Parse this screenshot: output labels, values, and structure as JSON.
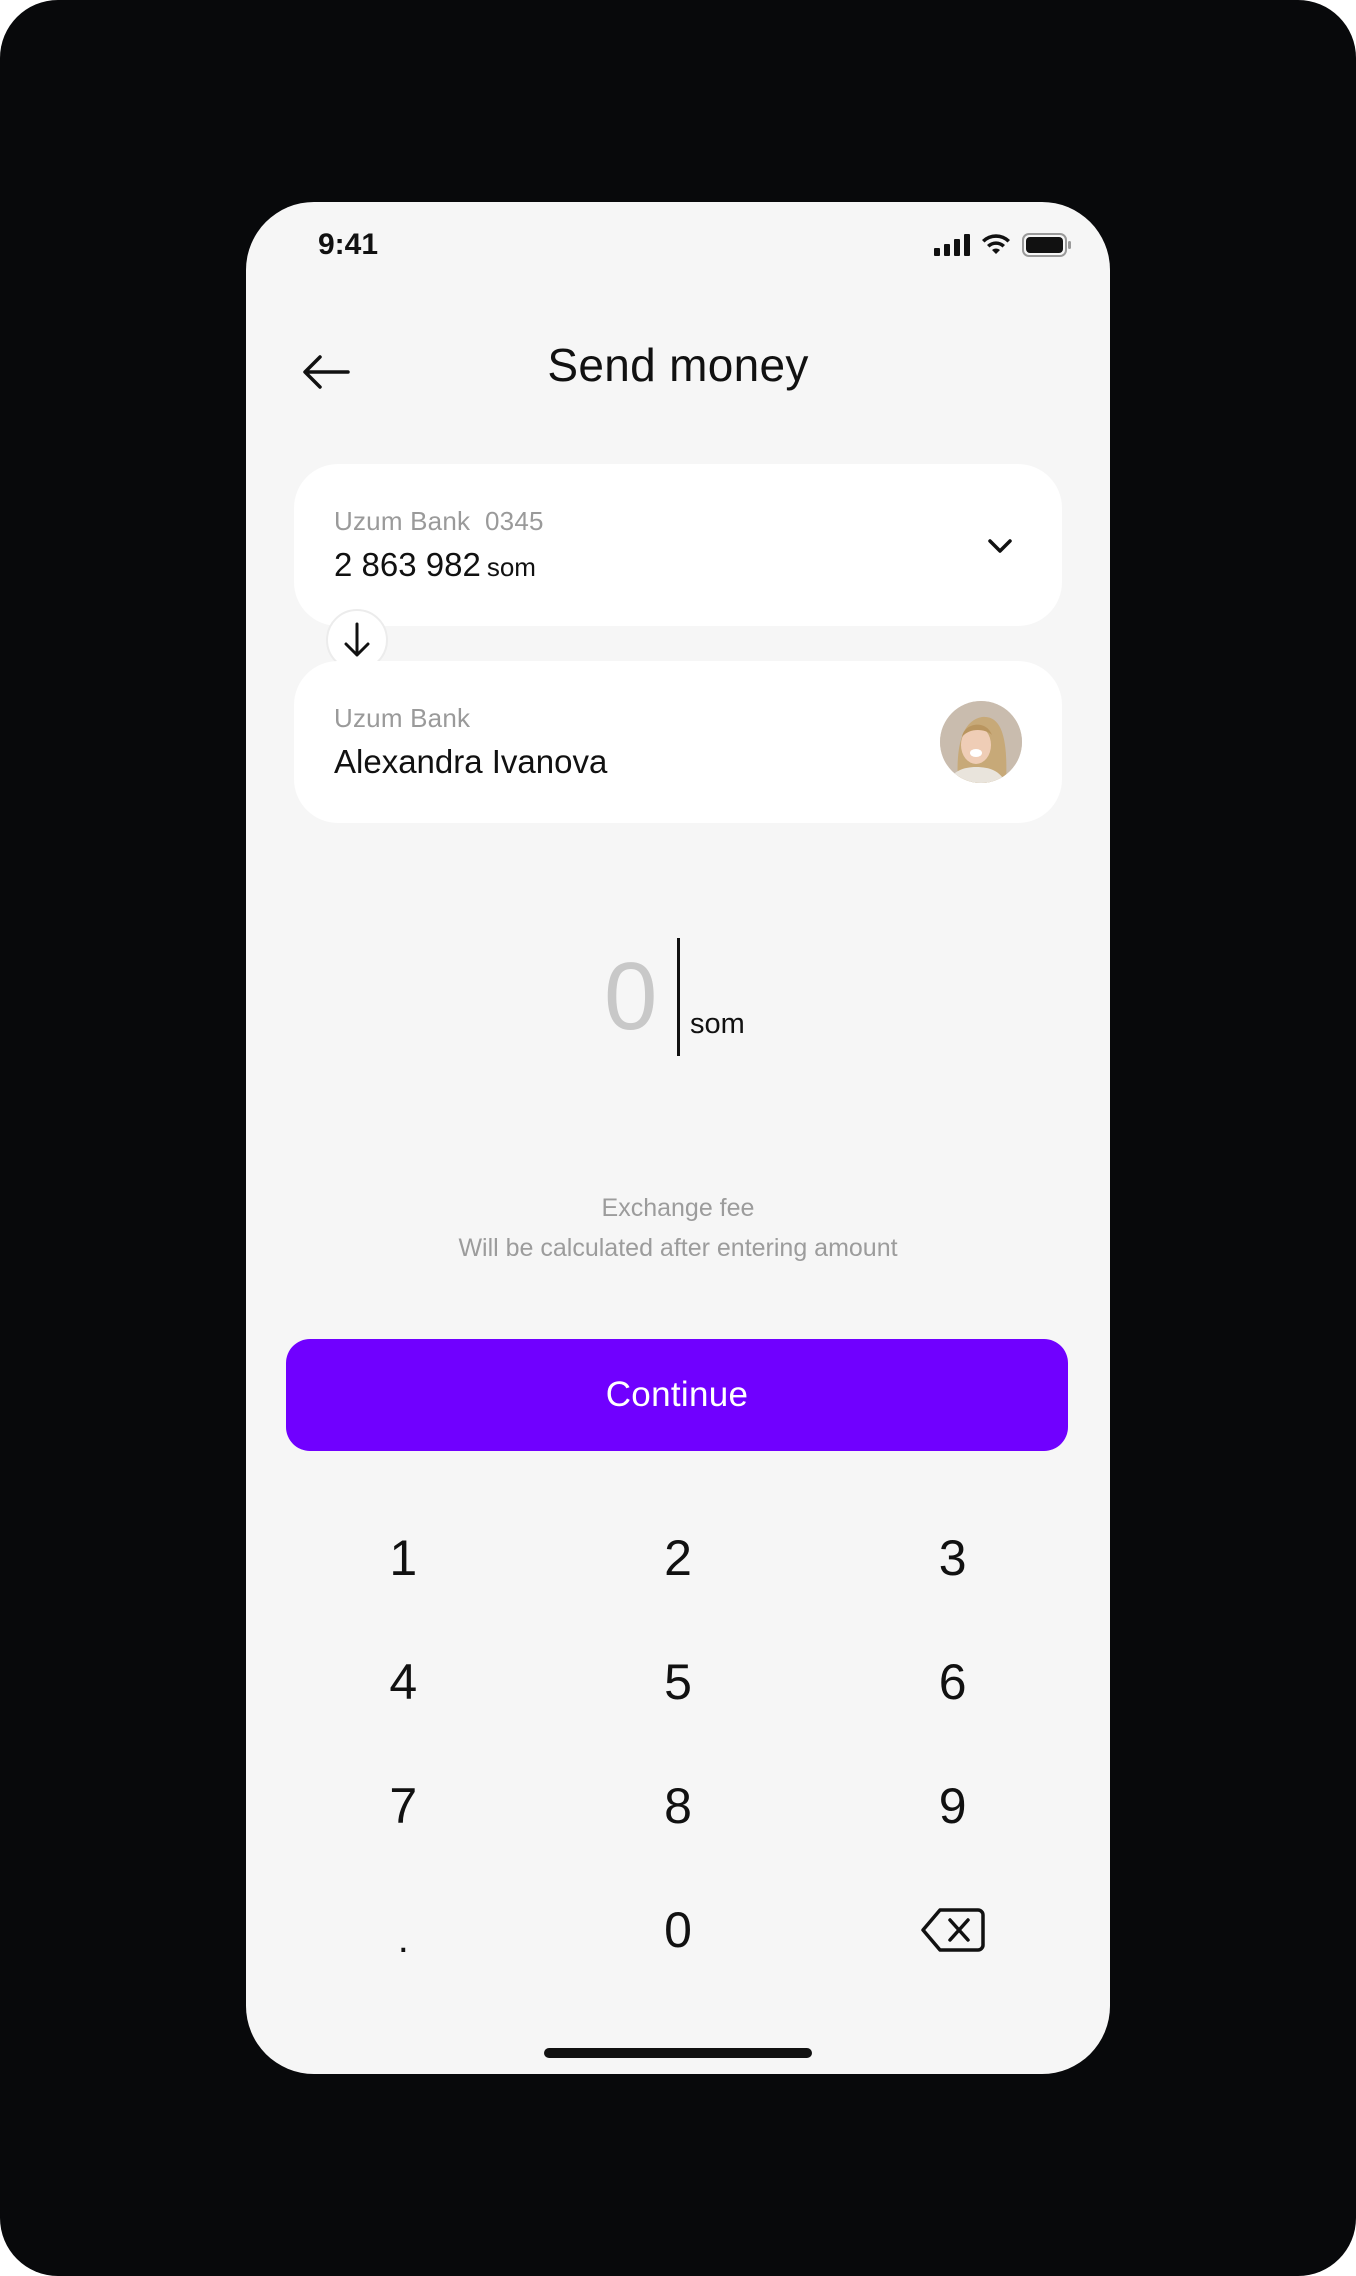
{
  "status_bar": {
    "time": "9:41",
    "icons": [
      "signal-icon",
      "wifi-icon",
      "battery-icon"
    ]
  },
  "header": {
    "title": "Send money",
    "back_icon": "arrow-left-icon"
  },
  "source_account": {
    "label": "Uzum Bank  0345",
    "balance": "2 863 982",
    "unit": "som",
    "dropdown_icon": "chevron-down-icon"
  },
  "swap_icon": "arrow-down-icon",
  "recipient": {
    "label": "Uzum Bank",
    "name": "Alexandra Ivanova",
    "avatar_icon": "avatar-photo"
  },
  "amount": {
    "value": "0",
    "unit": "som"
  },
  "fee": {
    "title": "Exchange fee",
    "description": "Will be calculated after entering amount"
  },
  "continue_button": {
    "label": "Continue",
    "color": "#7000ff"
  },
  "keypad": {
    "keys": [
      "1",
      "2",
      "3",
      "4",
      "5",
      "6",
      "7",
      "8",
      "9",
      ".",
      "0"
    ],
    "backspace_icon": "backspace-icon"
  },
  "colors": {
    "background": "#08090b",
    "screen": "#f6f6f6",
    "card": "#ffffff",
    "accent": "#7000ff",
    "muted_text": "#9a9a9a"
  }
}
